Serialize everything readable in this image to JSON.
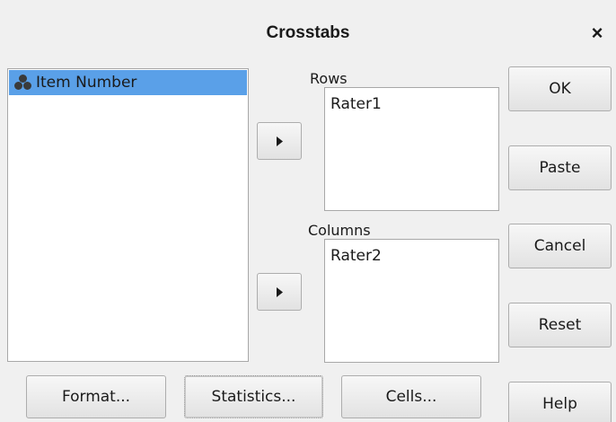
{
  "window": {
    "title": "Crosstabs",
    "close_glyph": "×"
  },
  "source_list": {
    "items": [
      {
        "label": "Item Number",
        "icon": "nominal-variable-icon",
        "selected": true
      }
    ],
    "selection_color": "#5aa0e8"
  },
  "rows": {
    "label": "Rows",
    "items": [
      "Rater1"
    ]
  },
  "columns": {
    "label": "Columns",
    "items": [
      "Rater2"
    ]
  },
  "arrows": {
    "rows_icon": "right-arrow-icon",
    "columns_icon": "right-arrow-icon"
  },
  "side_buttons": {
    "ok": "OK",
    "paste": "Paste",
    "cancel": "Cancel",
    "reset": "Reset",
    "help": "Help"
  },
  "bottom_buttons": {
    "format": "Format...",
    "statistics": "Statistics...",
    "cells": "Cells..."
  }
}
